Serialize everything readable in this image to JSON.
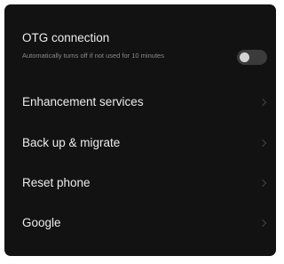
{
  "otg": {
    "title": "OTG connection",
    "description": "Automatically turns off if not used for 10 minutes",
    "enabled": false
  },
  "menu": {
    "items": [
      {
        "label": "Enhancement services"
      },
      {
        "label": "Back up & migrate"
      },
      {
        "label": "Reset phone"
      },
      {
        "label": "Google"
      }
    ]
  },
  "icons": {
    "row_arrow": "chevron-right-icon"
  },
  "colors": {
    "background": "#121212",
    "primary_text": "#ececec",
    "secondary_text": "#8a8a8a",
    "toggle_track_off": "#3b3b3b",
    "toggle_knob": "#d4d4d4",
    "chevron": "#444444"
  }
}
